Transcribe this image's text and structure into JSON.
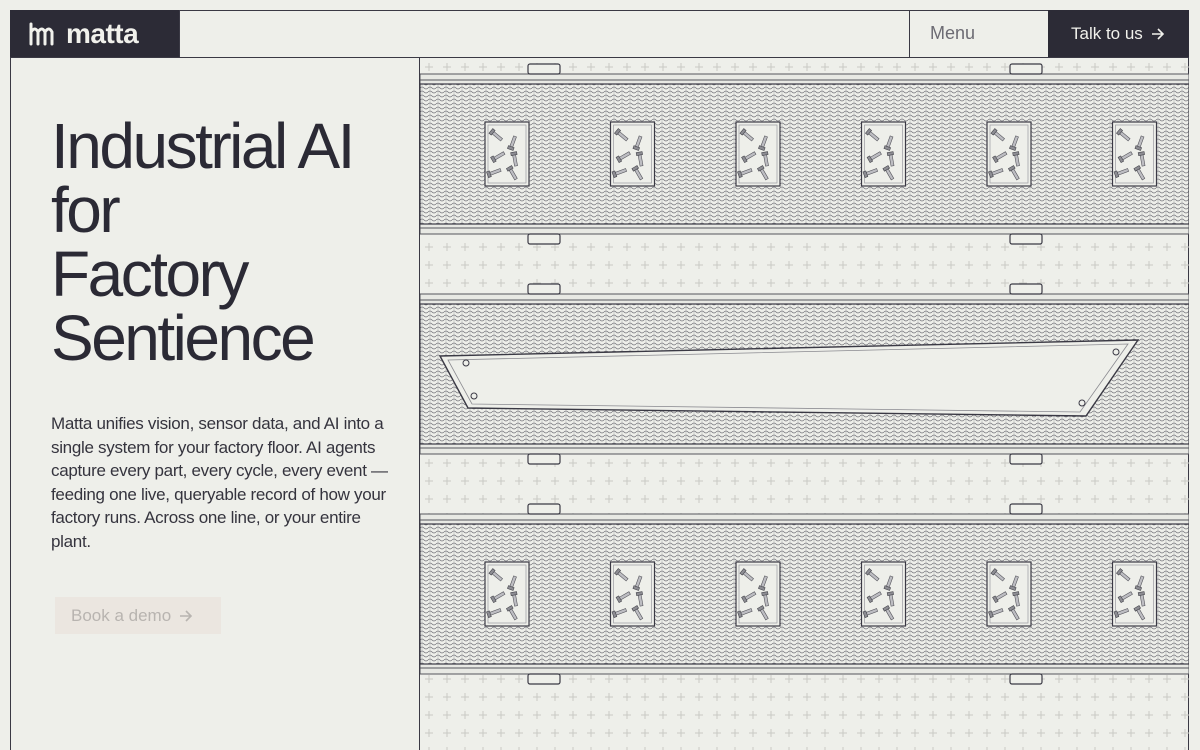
{
  "header": {
    "brand": "matta",
    "logo_icon": "matta-logo-icon",
    "menu_label": "Menu",
    "cta_label": "Talk to us",
    "cta_icon": "arrow-right-icon"
  },
  "hero": {
    "title_lines": [
      "Industrial AI",
      "for",
      "Factory",
      "Sentience"
    ],
    "description": "Matta unifies vision, sensor data, and AI into a single system for your factory floor. AI agents capture every part, every cycle, every event — feeding one live, queryable record of how your factory runs. Across one line, or your entire plant.",
    "demo_label": "Book a demo",
    "demo_icon": "arrow-right-icon"
  },
  "colors": {
    "background": "#eeefea",
    "dark": "#2c2b36",
    "line": "#3a3944",
    "demo_button_bg": "#ebe6e0",
    "demo_button_text": "#b8b4b0"
  },
  "illustration": {
    "name": "conveyor-belts-illustration",
    "belts": 3,
    "trays_per_belt": 6
  }
}
